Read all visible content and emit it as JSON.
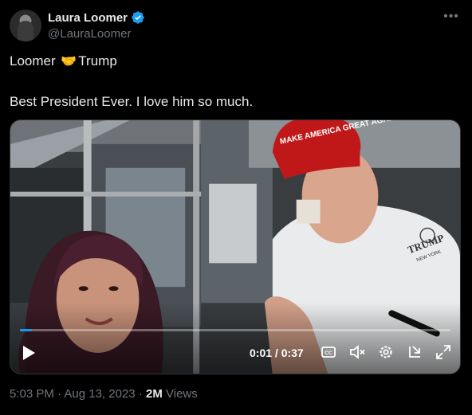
{
  "author": {
    "display_name": "Laura Loomer",
    "handle": "@LauraLoomer",
    "verified_icon": "verified-badge-icon",
    "avatar_icon": "profile-avatar"
  },
  "more_icon": "more-options-icon",
  "tweet": {
    "line1_before": "Loomer",
    "line1_emoji": "🤝",
    "line1_after": "Trump",
    "line2": "Best President Ever. I love him so much."
  },
  "video": {
    "hat_text": "MAKE AMERICA GREAT AGAIN",
    "shirt_logo": "TRUMP",
    "shirt_sub": "NEW YORK",
    "time": "0:01 / 0:37",
    "progress": 0.027,
    "icons": [
      "play-icon",
      "captions-icon",
      "mute-icon",
      "settings-icon",
      "share-icon",
      "fullscreen-icon"
    ]
  },
  "meta": {
    "time": "5:03 PM",
    "sep1": "·",
    "date": "Aug 13, 2023",
    "sep2": "·",
    "views_count": "2M",
    "views_label": "Views"
  },
  "colors": {
    "accent": "#1d9bf0",
    "background": "#000000",
    "text": "#e7e9ea",
    "muted": "#71767b"
  }
}
